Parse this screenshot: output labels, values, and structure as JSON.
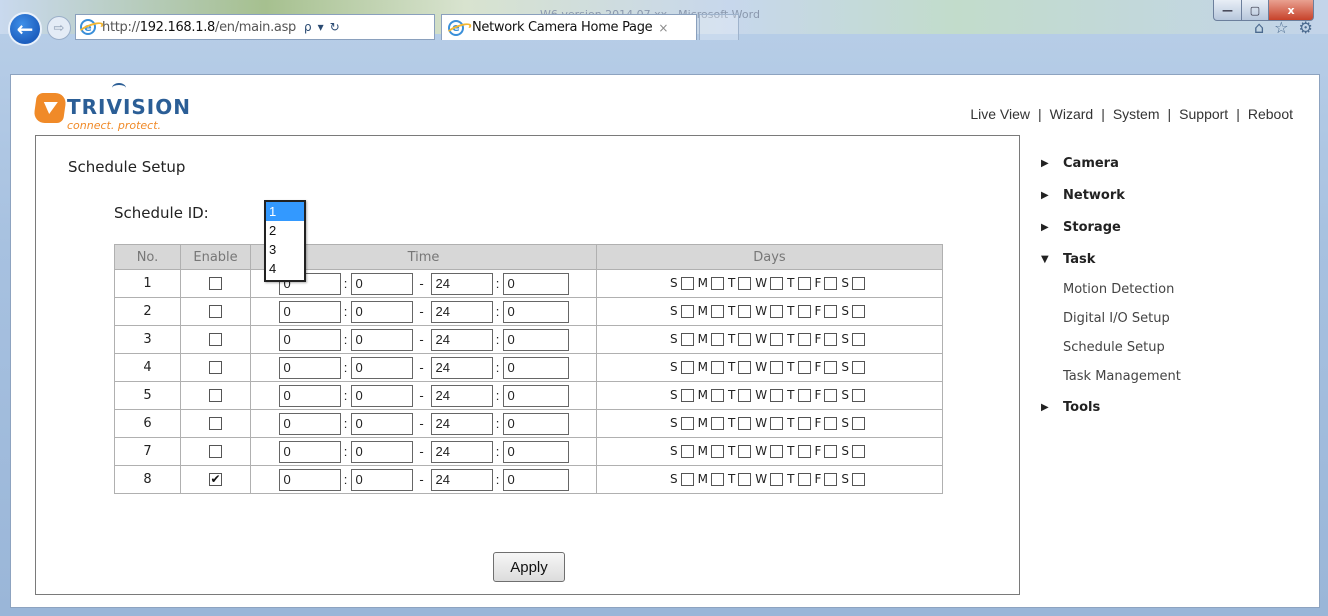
{
  "window": {
    "background_title": "W6 version 2014.07.xx - Microsoft Word",
    "min_glyph": "—",
    "max_glyph": "▢",
    "close_glyph": "x"
  },
  "browser": {
    "url_prefix": "http://",
    "url_host": "192.168.1.8",
    "url_path": "/en/main.asp",
    "tab_label": "Network Camera Home Page",
    "back_icon": "←",
    "forward_icon": "⇨",
    "search_icon": "ρ",
    "refresh_icon": "↻",
    "home_icon": "⌂",
    "star_icon": "☆",
    "gear_icon": "⚙",
    "tab_close": "×"
  },
  "brand": {
    "name": "TRIVISION",
    "tagline": "connect. protect.",
    "accent": "#f08a28",
    "blue": "#2b5e96"
  },
  "topnav": [
    "Live View",
    "Wizard",
    "System",
    "Support",
    "Reboot"
  ],
  "schedule": {
    "title": "Schedule Setup",
    "id_label": "Schedule ID:",
    "id_options": [
      "1",
      "2",
      "3",
      "4"
    ],
    "id_selected": "1",
    "headers": {
      "no": "No.",
      "enable": "Enable",
      "time": "Time",
      "days": "Days"
    },
    "time_sep": ":",
    "range_sep": "-",
    "day_letters": [
      "S",
      "M",
      "T",
      "W",
      "T",
      "F",
      "S"
    ],
    "rows": [
      {
        "no": "1",
        "enabled": false,
        "start_h": "0",
        "start_m": "0",
        "end_h": "24",
        "end_m": "0"
      },
      {
        "no": "2",
        "enabled": false,
        "start_h": "0",
        "start_m": "0",
        "end_h": "24",
        "end_m": "0"
      },
      {
        "no": "3",
        "enabled": false,
        "start_h": "0",
        "start_m": "0",
        "end_h": "24",
        "end_m": "0"
      },
      {
        "no": "4",
        "enabled": false,
        "start_h": "0",
        "start_m": "0",
        "end_h": "24",
        "end_m": "0"
      },
      {
        "no": "5",
        "enabled": false,
        "start_h": "0",
        "start_m": "0",
        "end_h": "24",
        "end_m": "0"
      },
      {
        "no": "6",
        "enabled": false,
        "start_h": "0",
        "start_m": "0",
        "end_h": "24",
        "end_m": "0"
      },
      {
        "no": "7",
        "enabled": false,
        "start_h": "0",
        "start_m": "0",
        "end_h": "24",
        "end_m": "0"
      },
      {
        "no": "8",
        "enabled": true,
        "start_h": "0",
        "start_m": "0",
        "end_h": "24",
        "end_m": "0"
      }
    ],
    "apply_label": "Apply"
  },
  "sidemenu": [
    {
      "label": "Camera",
      "expanded": false,
      "children": []
    },
    {
      "label": "Network",
      "expanded": false,
      "children": []
    },
    {
      "label": "Storage",
      "expanded": false,
      "children": []
    },
    {
      "label": "Task",
      "expanded": true,
      "children": [
        "Motion Detection",
        "Digital I/O Setup",
        "Schedule Setup",
        "Task Management"
      ]
    },
    {
      "label": "Tools",
      "expanded": false,
      "children": []
    }
  ]
}
